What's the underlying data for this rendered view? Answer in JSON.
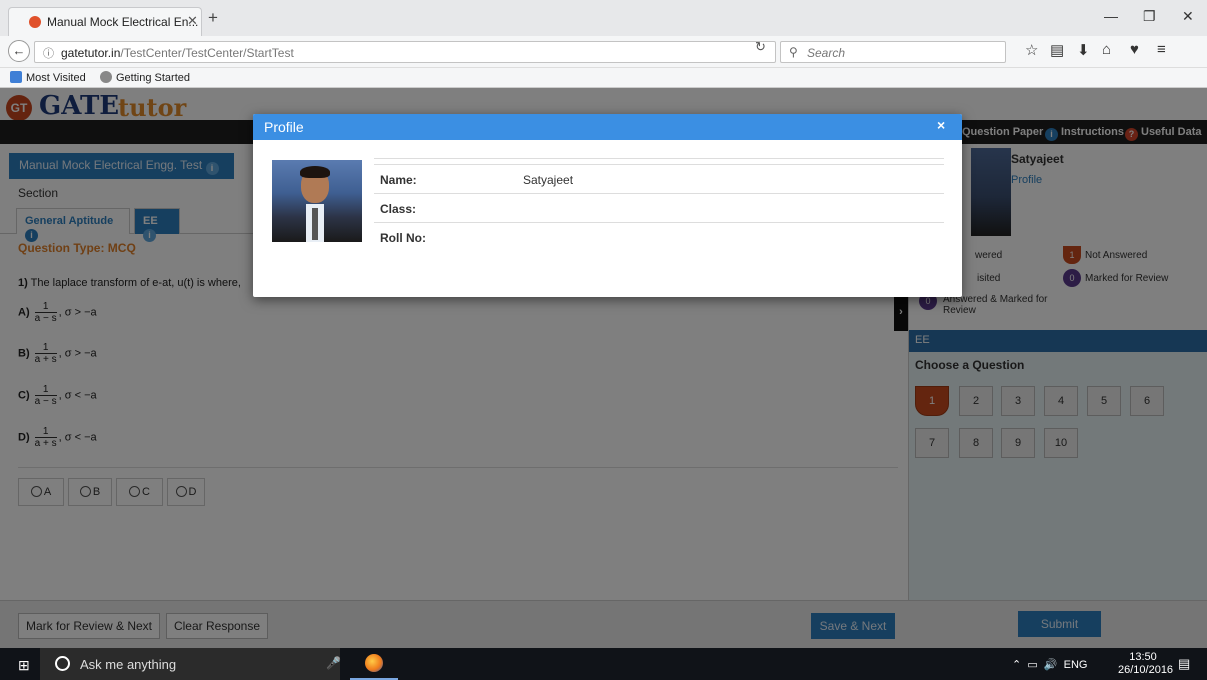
{
  "browser": {
    "tab_title": "Manual Mock Electrical En...",
    "url_host": "gatetutor.in",
    "url_path": "/TestCenter/TestCenter/StartTest",
    "search_placeholder": "Search",
    "bookmarks": [
      "Most Visited",
      "Getting Started"
    ]
  },
  "header": {
    "logo_gt": "GT",
    "logo_gate": "GATE",
    "logo_tutor": "tutor",
    "links": [
      "Question Paper",
      "Instructions",
      "Useful Data"
    ]
  },
  "test": {
    "name": "Manual Mock Electrical Engg. Test",
    "section_label": "Section",
    "tabs": [
      "General Aptitude",
      "EE"
    ],
    "question_type": "Question Type: MCQ",
    "question_number": "1)",
    "question_text": "The laplace transform of e-at, u(t) is where,",
    "options": [
      {
        "label": "A)",
        "num": "1",
        "den": "a − s",
        "cond": ",  σ > −a"
      },
      {
        "label": "B)",
        "num": "1",
        "den": "a + s",
        "cond": ",  σ > −a"
      },
      {
        "label": "C)",
        "num": "1",
        "den": "a − s",
        "cond": ",  σ < −a"
      },
      {
        "label": "D)",
        "num": "1",
        "den": "a + s",
        "cond": ",  σ < −a"
      }
    ],
    "answer_choices": [
      "A",
      "B",
      "C",
      "D"
    ],
    "buttons": {
      "mark_review": "Mark for Review & Next",
      "clear": "Clear Response",
      "save_next": "Save & Next",
      "submit": "Submit"
    }
  },
  "panel": {
    "user_name": "Satyajeet",
    "profile_link": "Profile",
    "legend": {
      "answered": "wered",
      "not_answered": "Not Answered",
      "not_answered_count": "1",
      "not_visited": "isited",
      "marked": "Marked for Review",
      "marked_count": "0",
      "answered_marked_1": "Answered & Marked for",
      "answered_marked_2": "Review",
      "answered_marked_count": "0"
    },
    "section_head": "EE",
    "choose_label": "Choose a Question",
    "questions": [
      "1",
      "2",
      "3",
      "4",
      "5",
      "6",
      "7",
      "8",
      "9",
      "10"
    ],
    "status_colors": {
      "not_answered": "#c84b1f",
      "marked": "#5b3a8c"
    }
  },
  "modal": {
    "title": "Profile",
    "close": "×",
    "fields": [
      {
        "key": "Name:",
        "value": "Satyajeet"
      },
      {
        "key": "Class:",
        "value": ""
      },
      {
        "key": "Roll No:",
        "value": ""
      }
    ]
  },
  "taskbar": {
    "search_placeholder": "Ask me anything",
    "lang": "ENG",
    "time": "13:50",
    "date": "26/10/2016"
  }
}
